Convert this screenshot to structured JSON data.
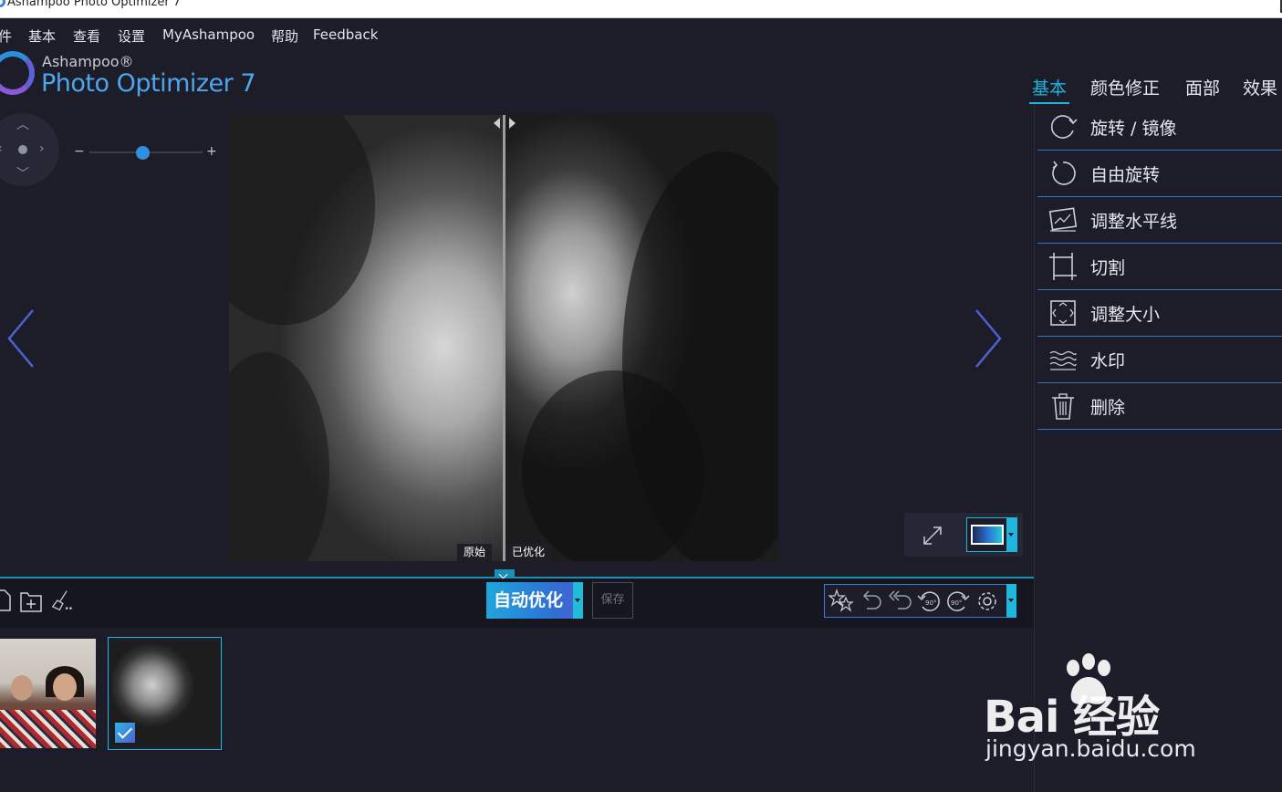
{
  "window": {
    "title": "Ashampoo Photo Optimizer 7"
  },
  "menu": [
    "件",
    "基本",
    "查看",
    "设置",
    "MyAshampoo",
    "帮助",
    "Feedback"
  ],
  "logo": {
    "brand": "Ashampoo®",
    "product": "Photo Optimizer 7"
  },
  "tabs": [
    {
      "label": "基本",
      "active": true
    },
    {
      "label": "颜色修正",
      "active": false
    },
    {
      "label": "面部",
      "active": false
    },
    {
      "label": "效果",
      "active": false
    }
  ],
  "viewer": {
    "zoom": {
      "minus": "−",
      "plus": "+",
      "level": 0.47
    },
    "compare": {
      "original_label": "原始",
      "optimized_label": "已优化"
    }
  },
  "toolbar": {
    "auto_optimize": "自动优化",
    "save": "保存"
  },
  "panel": {
    "items": [
      {
        "label": "旋转 / 镜像",
        "icon": "rotate-mirror-icon"
      },
      {
        "label": "自由旋转",
        "icon": "free-rotate-icon"
      },
      {
        "label": "调整水平线",
        "icon": "horizon-icon"
      },
      {
        "label": "切割",
        "icon": "crop-icon"
      },
      {
        "label": "调整大小",
        "icon": "resize-icon"
      },
      {
        "label": "水印",
        "icon": "watermark-icon"
      },
      {
        "label": "删除",
        "icon": "trash-icon"
      }
    ]
  },
  "watermark": {
    "brand": "Bai 经验",
    "domain": "jingyan.baidu.com"
  },
  "colors": {
    "accent": "#1fb6dd",
    "background": "#1c1d29",
    "divider": "#2f78c2"
  }
}
